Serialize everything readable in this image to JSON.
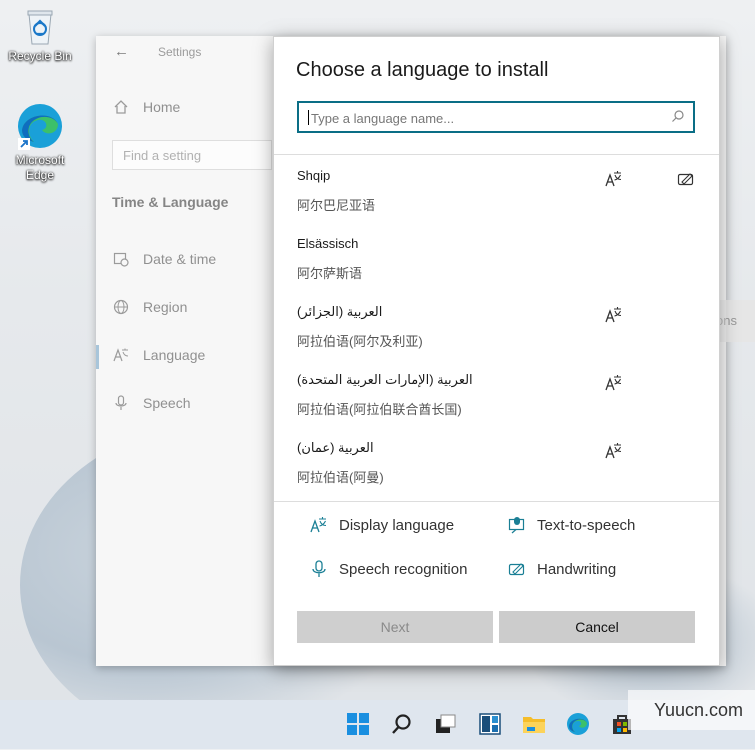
{
  "desktop": {
    "icons": [
      {
        "label": "Recycle Bin"
      },
      {
        "label": "Microsoft Edge"
      }
    ]
  },
  "settings": {
    "title": "Settings",
    "nav_home": "Home",
    "search_placeholder": "Find a setting",
    "section": "Time & Language",
    "nav": [
      {
        "label": "Date & time",
        "icon": "calendar-clock-icon"
      },
      {
        "label": "Region",
        "icon": "globe-icon"
      },
      {
        "label": "Language",
        "icon": "language-icon",
        "selected": true
      },
      {
        "label": "Speech",
        "icon": "microphone-icon"
      }
    ],
    "right_stub": "ons"
  },
  "dialog": {
    "title": "Choose a language to install",
    "search_placeholder": "Type a language name...",
    "languages": [
      {
        "name": "Shqip",
        "sub": "阿尔巴尼亚语",
        "display": true,
        "handwriting": true
      },
      {
        "name": "Elsässisch",
        "sub": "阿尔萨斯语",
        "display": false,
        "handwriting": false
      },
      {
        "name": "العربية (الجزائر)",
        "sub": "阿拉伯语(阿尔及利亚)",
        "display": true,
        "handwriting": false
      },
      {
        "name": "العربية (الإمارات العربية المتحدة)",
        "sub": "阿拉伯语(阿拉伯联合酋长国)",
        "display": true,
        "handwriting": false
      },
      {
        "name": "العربية (عمان)",
        "sub": "阿拉伯语(阿曼)",
        "display": true,
        "handwriting": false
      }
    ],
    "features": {
      "display_language": "Display language",
      "text_to_speech": "Text-to-speech",
      "speech_recognition": "Speech recognition",
      "handwriting": "Handwriting"
    },
    "next_label": "Next",
    "cancel_label": "Cancel"
  },
  "taskbar": {
    "items": [
      "start-icon",
      "search-icon",
      "task-view-icon",
      "widgets-icon",
      "file-explorer-icon",
      "edge-icon",
      "store-icon"
    ]
  },
  "watermark": "Yuucn.com",
  "colors": {
    "accent": "#0a6e86",
    "icon_teal": "#1a7f95"
  }
}
